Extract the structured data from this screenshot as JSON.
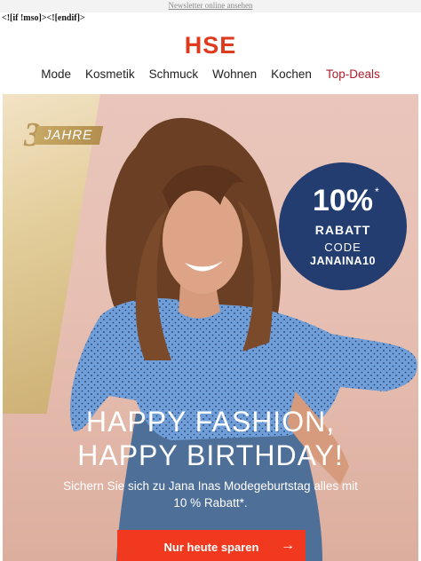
{
  "header": {
    "newsletter_link": "Newsletter online ansehen",
    "mso_text": "<![if !mso]><![endif]>",
    "logo": "HSE"
  },
  "nav": {
    "items": [
      "Mode",
      "Kosmetik",
      "Schmuck",
      "Wohnen",
      "Kochen",
      "Top-Deals"
    ]
  },
  "hero": {
    "badge_number": "3",
    "badge_text": "JAHRE",
    "promo": {
      "percent": "10%",
      "star": "*",
      "rabatt": "RABATT",
      "code_label": "CODE",
      "code_value": "JANAINA10"
    },
    "headline_1": "HAPPY FASHION,",
    "headline_2": "HAPPY BIRTHDAY!",
    "subline": "Sichern Sie sich zu Jana Inas Modegeburtstag alles mit 10 % Rabatt*.",
    "cta_label": "Nur heute sparen",
    "cta_icon": "arrow-right-icon"
  },
  "colors": {
    "brand": "#e03a1e",
    "deals": "#b01d2c",
    "promo_circle": "#233d71",
    "cta": "#f0391f",
    "gold": "#c8a865"
  }
}
